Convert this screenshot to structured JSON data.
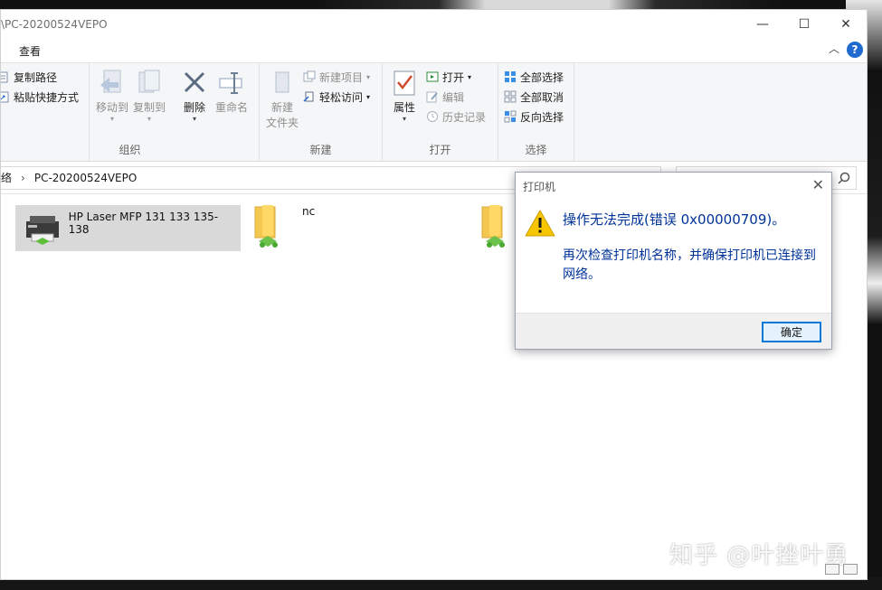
{
  "window": {
    "title": "\\PC-20200524VEPO",
    "controls": {
      "minimize": "—",
      "maximize": "☐",
      "close": "✕"
    }
  },
  "menu": {
    "view": "查看",
    "help": "?"
  },
  "ribbon": {
    "organize": {
      "copy_path": "复制路径",
      "paste_shortcut": "粘贴快捷方式",
      "move_to": "移动到",
      "copy_to": "复制到",
      "delete": "删除",
      "rename": "重命名",
      "label": "组织"
    },
    "new": {
      "new_folder_line1": "新建",
      "new_folder_line2": "文件夹",
      "new_item": "新建项目",
      "easy_access": "轻松访问",
      "label": "新建"
    },
    "open": {
      "properties": "属性",
      "open": "打开",
      "edit": "编辑",
      "history": "历史记录",
      "label": "打开"
    },
    "select": {
      "select_all": "全部选择",
      "select_none": "全部取消",
      "invert": "反向选择",
      "label": "选择"
    }
  },
  "address": {
    "network": "络",
    "separator": "›",
    "computer": "PC-20200524VEPO"
  },
  "items": [
    {
      "label": "HP Laser MFP 131 133 135-138",
      "icon": "printer-icon",
      "selected": true
    },
    {
      "label": "nc",
      "icon": "shared-folder-icon"
    },
    {
      "label": "",
      "icon": "shared-folder-icon"
    }
  ],
  "dialog": {
    "title": "打印机",
    "main_message": "操作无法完成(错误 0x00000709)。",
    "detail": "再次检查打印机名称，并确保打印机已连接到网络。",
    "ok": "确定",
    "text_color": "#003399"
  },
  "watermark": "知乎 @叶挫叶勇",
  "colors": {
    "accent": "#0078d7",
    "selection": "#d9d9d9",
    "ribbon_bg": "#f5f6f7"
  }
}
